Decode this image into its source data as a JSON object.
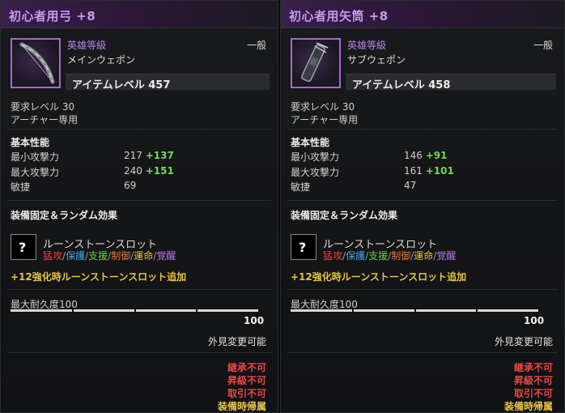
{
  "colors": {
    "title": "#c79af0",
    "grade": "#b784e8",
    "bonus": "#7ad35a",
    "enhance": "#e6c34a",
    "restrict": "#e24a45",
    "bind": "#e8c64b",
    "rune_red": "#e8463f",
    "rune_blue": "#4ea5e6",
    "rune_green": "#6ccb4c",
    "rune_orange": "#e07a30",
    "rune_yellow": "#e8c64b",
    "rune_purple": "#b57be8"
  },
  "items": [
    {
      "title": "初心者用弓 +8",
      "icon": "bow-icon",
      "grade": "英雄等級",
      "subtype": "メインウェポン",
      "rarity": "一般",
      "item_level": "アイテムレベル 457",
      "req_level": "要求レベル 30",
      "class_req": "アーチャー専用",
      "basic_header": "基本性能",
      "stats": [
        {
          "name": "最小攻撃力",
          "base": "217",
          "bonus": "+137"
        },
        {
          "name": "最大攻撃力",
          "base": "240",
          "bonus": "+151"
        },
        {
          "name": "敏捷",
          "base": "69",
          "bonus": ""
        }
      ],
      "effects_header": "装備固定＆ランダム効果",
      "rune_icon": "?",
      "rune_title": "ルーンストーンスロット",
      "rune_types": [
        "猛攻",
        "保護",
        "支援",
        "制御",
        "運命",
        "覚醒"
      ],
      "enhance_note": "+12強化時ルーンストーンスロット追加",
      "durability_label": "最大耐久度100",
      "durability_value": "100",
      "durability_fraction": 1.0,
      "appearance": "外見変更可能",
      "restrictions": [
        "継承不可",
        "昇級不可",
        "取引不可"
      ],
      "bind": "装備時帰属"
    },
    {
      "title": "初心者用矢筒 +8",
      "icon": "quiver-icon",
      "grade": "英雄等級",
      "subtype": "サブウェポン",
      "rarity": "一般",
      "item_level": "アイテムレベル 458",
      "req_level": "要求レベル 30",
      "class_req": "アーチャー専用",
      "basic_header": "基本性能",
      "stats": [
        {
          "name": "最小攻撃力",
          "base": "146",
          "bonus": "+91"
        },
        {
          "name": "最大攻撃力",
          "base": "161",
          "bonus": "+101"
        },
        {
          "name": "敏捷",
          "base": "47",
          "bonus": ""
        }
      ],
      "effects_header": "装備固定＆ランダム効果",
      "rune_icon": "?",
      "rune_title": "ルーンストーンスロット",
      "rune_types": [
        "猛攻",
        "保護",
        "支援",
        "制御",
        "運命",
        "覚醒"
      ],
      "enhance_note": "+12強化時ルーンストーンスロット追加",
      "durability_label": "最大耐久度100",
      "durability_value": "100",
      "durability_fraction": 1.0,
      "appearance": "外見変更可能",
      "restrictions": [
        "継承不可",
        "昇級不可",
        "取引不可"
      ],
      "bind": "装備時帰属"
    }
  ]
}
